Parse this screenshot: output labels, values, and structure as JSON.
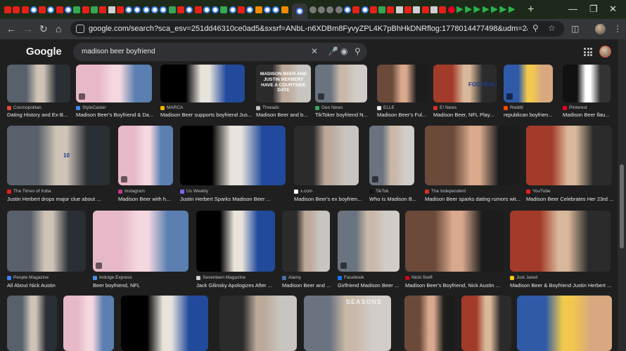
{
  "browser": {
    "new_tab": "+",
    "controls": [
      "—",
      "❐",
      "✕"
    ],
    "url": "google.com/search?sca_esv=251dd46310ce0ad5&sxsrf=ANbL-n6XDBm8FyvyZPL4K7pBhHkDNRflog:1778014477498&udm=2&fbs=ADc_l-aN0CWEZBOH..."
  },
  "google": {
    "logo": "Google",
    "query": "madison beer boyfriend"
  },
  "results": {
    "row1": [
      {
        "source": "Cosmopolitan",
        "caption": "Dating History and Ex-B..."
      },
      {
        "source": "StyleCaster",
        "caption": "Madison Beer's Boyfriend & Da..."
      },
      {
        "source": "MARCA",
        "caption": "Madison Beer supports boyfriend Jus..."
      },
      {
        "source": "Threads",
        "caption": "Madison Beer and b...",
        "overlay": "MADISON BEER AND JUSTIN HERBERT HAVE A COURTSIDE DATE"
      },
      {
        "source": "Geo News",
        "caption": "TikToker boyfriend N..."
      },
      {
        "source": "ELLE",
        "caption": "Madison Beer's Ful..."
      },
      {
        "source": "E! News",
        "caption": "Madison Beer, NFL Play...",
        "jersey": "FOOTBALL"
      },
      {
        "source": "Reddit",
        "caption": "republican boyfrien..."
      },
      {
        "source": "Pinterest",
        "caption": "Madison Beer flau..."
      }
    ],
    "row2": [
      {
        "source": "The Times of India",
        "caption": "Justin Herbert drops major clue about ...",
        "jersey": "10"
      },
      {
        "source": "Instagram",
        "caption": "Madison Beer with h..."
      },
      {
        "source": "Us Weekly",
        "caption": "Justin Herbert Sparks Madison Beer ..."
      },
      {
        "source": "x.com",
        "caption": "Madison Beer's ex boyfrien..."
      },
      {
        "source": "TikTok",
        "caption": "Who Is Madison B..."
      },
      {
        "source": "The Independent",
        "caption": "Madison Beer sparks dating rumors wit..."
      },
      {
        "source": "YouTube",
        "caption": "Madison Beer Celebrates Her 23rd ..."
      }
    ],
    "row3": [
      {
        "source": "People Magazine",
        "caption": "All About Nick Austin"
      },
      {
        "source": "Indulge Express",
        "caption": "Beer boyfriend, NFL"
      },
      {
        "source": "Seventeen Magazine",
        "caption": "Jack Gilinsky Apologizes After ..."
      },
      {
        "source": "Alamy",
        "caption": "Madison Beer and ..."
      },
      {
        "source": "Facebook",
        "caption": "Girlfriend Madison Beer ..."
      },
      {
        "source": "Nicki Swift",
        "caption": "Madison Beer's Boyfriend, Nick Austin ..."
      },
      {
        "source": "Just Jared",
        "caption": "Madison Beer & Boyfriend Justin Herbert ..."
      }
    ],
    "row4_banner": "SEASONS"
  },
  "colors": {
    "tabstrip": "#1d2a1a",
    "toolbar": "#35363a",
    "page_bg": "#1f1f1f",
    "search_bg": "#303134"
  }
}
